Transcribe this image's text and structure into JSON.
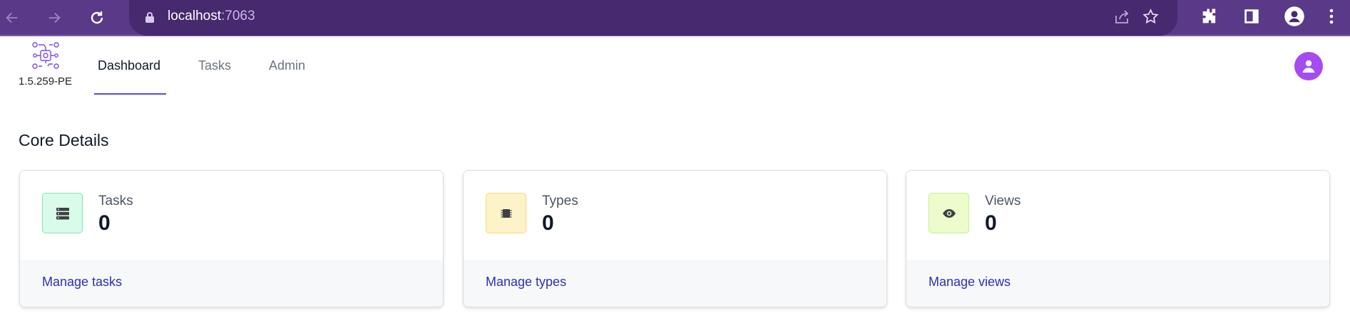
{
  "browser": {
    "url_host": "localhost",
    "url_port": ":7063"
  },
  "app": {
    "version": "1.5.259-PE",
    "nav": [
      {
        "label": "Dashboard",
        "active": true
      },
      {
        "label": "Tasks",
        "active": false
      },
      {
        "label": "Admin",
        "active": false
      }
    ]
  },
  "section": {
    "title": "Core Details"
  },
  "cards": [
    {
      "label": "Tasks",
      "count": "0",
      "link": "Manage tasks",
      "icon": "server-stack-icon",
      "icon_bg": "#d9fbe9",
      "icon_border": "#86e3b7"
    },
    {
      "label": "Types",
      "count": "0",
      "link": "Manage types",
      "icon": "chip-icon",
      "icon_bg": "#fdf3c8",
      "icon_border": "#f5d978"
    },
    {
      "label": "Views",
      "count": "0",
      "link": "Manage views",
      "icon": "eye-icon",
      "icon_bg": "#ecfccb",
      "icon_border": "#c7ee8f"
    }
  ],
  "colors": {
    "browser_frame": "#5a3a88",
    "omnibox": "#46296f",
    "accent": "#5b4bd6",
    "avatar": "#a64bef",
    "link": "#2f2fb4"
  }
}
